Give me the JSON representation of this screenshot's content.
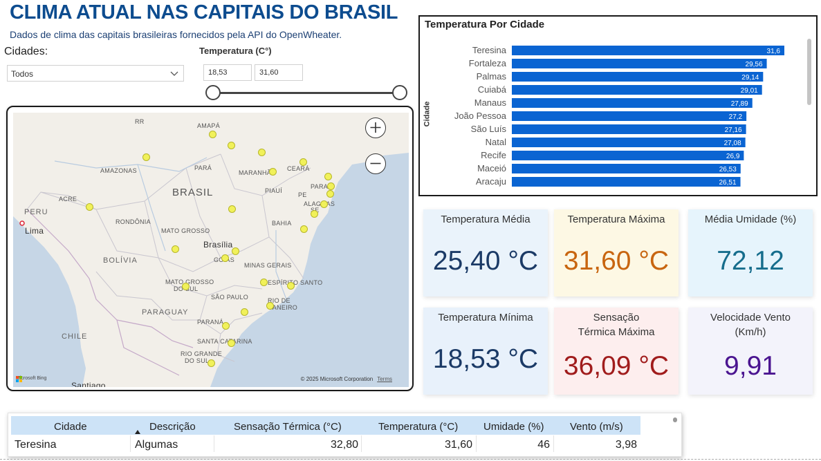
{
  "header": {
    "title": "CLIMA ATUAL NAS CAPITAIS DO BRASIL",
    "subtitle": "Dados de clima das capitais brasileiras fornecidos pela API do OpenWheater."
  },
  "filters": {
    "cidades_label": "Cidades:",
    "cidades_value": "Todos",
    "temperatura_label": "Temperatura (C°)",
    "temp_min": "18,53",
    "temp_max": "31,60"
  },
  "map": {
    "labels": {
      "rr": "RR",
      "amapa": "AMAPÁ",
      "amazonas": "AMAZONAS",
      "para": "PARÁ",
      "maranhao": "MARANHÃO",
      "ceara": "CEARÁ",
      "piaui": "PIAUÍ",
      "paraiba": "PARAÍ",
      "pe": "PE",
      "alagoas": "ALAGOAS",
      "se": "SE",
      "brasil": "BRASIL",
      "acre": "ACRE",
      "rondonia": "RONDÔNIA",
      "mato_grosso": "MATO GROSSO",
      "bahia": "BAHIA",
      "brasilia": "Brasília",
      "goias": "GOIÁS",
      "minas_gerais": "MINAS GERAIS",
      "peru": "PERU",
      "lima": "Lima",
      "bolivia": "BOLÍVIA",
      "mato_grosso_sul_1": "MATO GROSSO",
      "mato_grosso_sul_2": "DO SUL",
      "espirito_santo": "ESPÍRITO SANTO",
      "sao_paulo": "SÃO PAULO",
      "rio_1": "RIO DE",
      "rio_2": "JANEIRO",
      "paraguay": "PARAGUAY",
      "parana": "PARANÁ",
      "chile": "CHILE",
      "santa_catarina": "SANTA CATARINA",
      "rio_grande_1": "RIO GRANDE",
      "rio_grande_2": "DO SUL",
      "santiago": "Santiago"
    },
    "zoom_in": "+",
    "zoom_out": "−",
    "bing": "Microsoft Bing",
    "copyright": "© 2025 Microsoft Corporation",
    "terms": "Terms"
  },
  "chart": {
    "title": "Temperatura Por Cidade",
    "ylabel": "Cidade"
  },
  "chart_data": {
    "type": "bar",
    "orientation": "horizontal",
    "title": "Temperatura Por Cidade",
    "ylabel": "Cidade",
    "xlabel": "",
    "categories": [
      "Teresina",
      "Fortaleza",
      "Palmas",
      "Cuiabá",
      "Manaus",
      "João Pessoa",
      "São Luís",
      "Natal",
      "Recife",
      "Maceió",
      "Aracaju"
    ],
    "values": [
      31.6,
      29.56,
      29.14,
      29.01,
      27.89,
      27.2,
      27.16,
      27.08,
      26.9,
      26.53,
      26.51
    ],
    "labels": [
      "31,6",
      "29,56",
      "29,14",
      "29,01",
      "27,89",
      "27,2",
      "27,16",
      "27,08",
      "26,9",
      "26,53",
      "26,51"
    ],
    "xlim": [
      0,
      31.6
    ],
    "bar_color": "#0a64d2",
    "grid": false
  },
  "kpis": {
    "media": {
      "label": "Temperatura Média",
      "value": "25,40 °C",
      "color": "#1b3a66",
      "bg": "#eaf3fb"
    },
    "maxima": {
      "label": "Temperatura Máxima",
      "value": "31,60 °C",
      "color": "#c8650f",
      "bg": "#fdf8e4"
    },
    "umidade": {
      "label": "Média Umidade (%)",
      "value": "72,12",
      "color": "#166d8c",
      "bg": "#e6f4fc"
    },
    "minima": {
      "label": "Temperatura Mínima",
      "value": "18,53 °C",
      "color": "#1b3a66",
      "bg": "#e8f1fb"
    },
    "sensacao": {
      "label": "Sensação Térmica Máxima",
      "value": "36,09 °C",
      "color": "#a01c1c",
      "bg": "#fdeeee"
    },
    "vento": {
      "label": "Velocidade Vento (Km/h)",
      "value": "9,91",
      "color": "#4a1490",
      "bg": "#f3f3fb"
    }
  },
  "table": {
    "headers": [
      "Cidade",
      "Descrição",
      "Sensação Térmica (°C)",
      "Temperatura (°C)",
      "Umidade (%)",
      "Vento (m/s)"
    ],
    "rows": [
      [
        "Teresina",
        "Algumas",
        "32,80",
        "31,60",
        "46",
        "3,98"
      ]
    ]
  }
}
